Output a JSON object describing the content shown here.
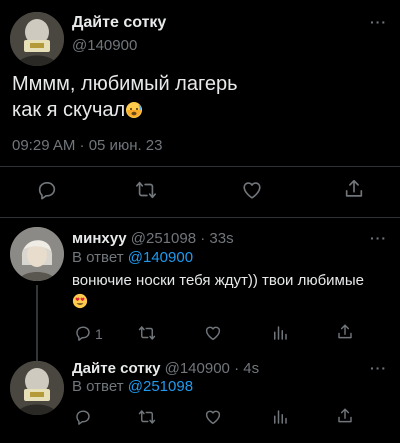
{
  "main_tweet": {
    "author_name": "Дайте сотку",
    "author_handle": "@140900",
    "text_line1": "Мммм, любимый лагерь",
    "text_line2": "как я скучал",
    "emoji": "hot-face-emoji",
    "timestamp": "09:29 AM · 05 июн. 23"
  },
  "reply1": {
    "author_name": "минхуу",
    "author_handle": "@251098",
    "time": "· 33s",
    "reply_to_prefix": "В ответ",
    "reply_to_handle": "@140900",
    "text": "вонючие носки тебя ждут)) твои любимые",
    "emoji": "smiling-face-with-heart-eyes-emoji",
    "reply_count": "1"
  },
  "reply2": {
    "author_name": "Дайте сотку",
    "author_handle": "@140900",
    "time": "· 4s",
    "reply_to_prefix": "В ответ",
    "reply_to_handle": "@251098"
  },
  "more_label": "···",
  "colors": {
    "background": "#000000",
    "text": "#e7e9ea",
    "muted": "#71767b",
    "link": "#1d9bf0",
    "divider": "#2f3336"
  }
}
